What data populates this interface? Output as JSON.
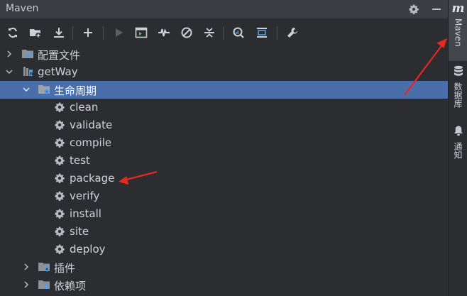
{
  "panel": {
    "title": "Maven"
  },
  "toolbar": {
    "icons": [
      "reload-icon",
      "add-folder-icon",
      "download-icon",
      "plus-icon",
      "run-icon",
      "run-config-icon",
      "toggle-offline-icon",
      "skip-tests-icon",
      "collapse-all-icon",
      "analyze-icon",
      "expand-icon",
      "settings-wrench-icon"
    ]
  },
  "tree": {
    "profiles_label": "配置文件",
    "project_label": "getWay",
    "lifecycle_label": "生命周期",
    "phases": [
      "clean",
      "validate",
      "compile",
      "test",
      "package",
      "verify",
      "install",
      "site",
      "deploy"
    ],
    "plugins_label": "插件",
    "deps_label": "依赖项"
  },
  "rightbar": {
    "maven_logo": "m",
    "maven_label": "Maven",
    "database_label": "数据库",
    "notifications_label": "通知"
  },
  "colors": {
    "selection": "#4a6ea9",
    "annotation_arrow": "#e8271f"
  }
}
